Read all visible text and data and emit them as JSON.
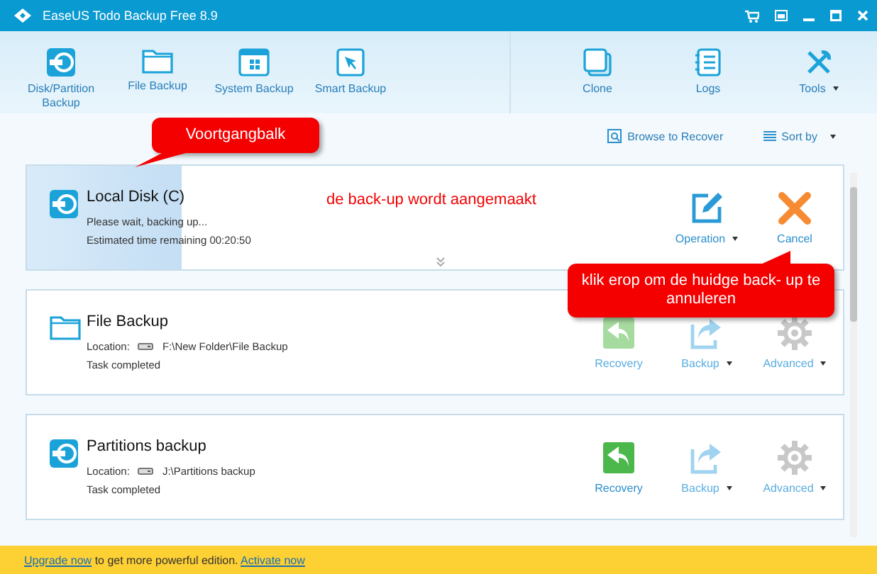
{
  "window": {
    "title": "EaseUS Todo Backup Free 8.9"
  },
  "toolbar": {
    "left": [
      {
        "kind": "disk",
        "label": "Disk/Partition\nBackup"
      },
      {
        "kind": "folder",
        "label": "File Backup"
      },
      {
        "kind": "system",
        "label": "System Backup"
      },
      {
        "kind": "smart",
        "label": "Smart Backup"
      }
    ],
    "right": [
      {
        "kind": "clone",
        "label": "Clone",
        "dropdown": false
      },
      {
        "kind": "logs",
        "label": "Logs",
        "dropdown": false
      },
      {
        "kind": "tools",
        "label": "Tools",
        "dropdown": true
      }
    ]
  },
  "list_header": {
    "browse": "Browse to Recover",
    "sort": "Sort by"
  },
  "tasks": [
    {
      "kind": "disk",
      "title": "Local Disk (C)",
      "running": true,
      "level": 0.19,
      "lines": [
        "Please wait, backing up...",
        "Estimated time remaining 00:20:50"
      ],
      "actions": [
        {
          "kind": "edit",
          "label": "Operation",
          "dropdown": true,
          "enabled": true
        },
        {
          "kind": "cancel",
          "label": "Cancel",
          "dropdown": false,
          "enabled": true
        }
      ]
    },
    {
      "kind": "folder",
      "title": "File Backup",
      "running": false,
      "location_label": "Location:",
      "location": "F:\\New Folder\\File Backup",
      "lines": [
        "Task completed"
      ],
      "actions": [
        {
          "kind": "recovery",
          "label": "Recovery",
          "dropdown": false,
          "enabled": false
        },
        {
          "kind": "backup",
          "label": "Backup",
          "dropdown": true,
          "enabled": false
        },
        {
          "kind": "advanced",
          "label": "Advanced",
          "dropdown": true,
          "enabled": false
        }
      ]
    },
    {
      "kind": "disk",
      "title": "Partitions backup",
      "running": false,
      "location_label": "Location:",
      "location": "J:\\Partitions backup",
      "lines": [
        "Task completed"
      ],
      "actions": [
        {
          "kind": "recovery",
          "label": "Recovery",
          "dropdown": false,
          "enabled": true
        },
        {
          "kind": "backup",
          "label": "Backup",
          "dropdown": true,
          "enabled": false
        },
        {
          "kind": "advanced",
          "label": "Advanced",
          "dropdown": true,
          "enabled": false
        }
      ]
    }
  ],
  "footer": [
    {
      "kind": "link",
      "text": "Upgrade now"
    },
    {
      "kind": "text",
      "text": " to get more powerful edition. "
    },
    {
      "kind": "link",
      "text": "Activate now"
    }
  ],
  "annotations": [
    {
      "kind": "bubble",
      "text": "Voortgangbalk"
    },
    {
      "kind": "text",
      "text": "de back-up wordt aangemaakt"
    },
    {
      "kind": "bubble",
      "text": "klik erop om de huidge back- up te annuleren"
    }
  ]
}
